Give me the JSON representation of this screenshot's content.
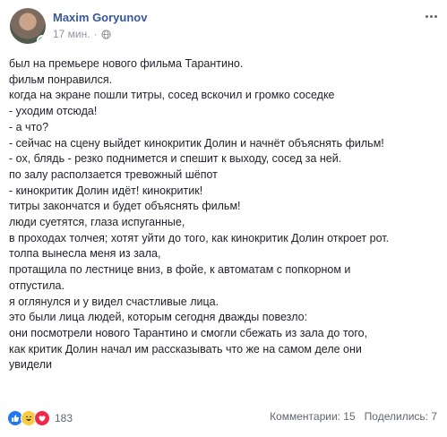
{
  "post": {
    "author": "Maxim Goryunov",
    "timestamp": "17 мин.",
    "privacy_icon": "globe-icon",
    "more_icon": "more-icon",
    "lines": [
      "был на премьере нового фильма Тарантино.",
      "фильм понравился.",
      "когда на экране пошли титры, сосед вскочил и громко соседке",
      "- уходим отсюда!",
      "- а что?",
      "- сейчас на сцену выйдет кинокритик Долин и начнёт объяснять фильм!",
      "- ох, блядь - резко поднимется и спешит к выходу, сосед за ней.",
      "по залу расползается тревожный шёпот",
      "- кинокритик Долин идёт! кинокритик!",
      "титры закончатся и будет объяснять фильм!",
      "люди суетятся, глаза испуганные,",
      "в проходах толчея; хотят уйти до того, как кинокритик Долин откроет рот.",
      "толпа вынесла меня из зала,",
      "протащила по лестнице вниз, в фойе, к автоматам с попкорном и",
      "отпустила.",
      "я оглянулся и у видел счастливые лица.",
      "это были лица людей, которым сегодня дважды повезло:",
      "они посмотрели нового Тарантино и смогли сбежать из зала до того,",
      "как критик Долин начал им рассказывать что же на самом деле они",
      "увидели"
    ]
  },
  "footer": {
    "reactions": [
      {
        "icon": "like-icon",
        "color": "#2078f4"
      },
      {
        "icon": "haha-icon",
        "color": "#f7cc45"
      },
      {
        "icon": "love-icon",
        "color": "#f0284a"
      }
    ],
    "reaction_count": "183",
    "comments": "Комментарии: 15",
    "shares": "Поделились: 7"
  },
  "colors": {
    "author_link": "#385898",
    "meta_text": "#90949c",
    "online": "#42b72a"
  }
}
